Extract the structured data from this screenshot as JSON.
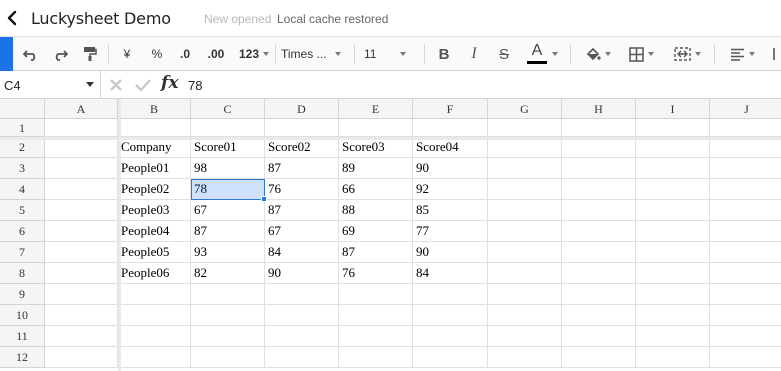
{
  "app": {
    "title": "Luckysheet Demo",
    "status_new": "New opened",
    "status_cache": "Local cache restored"
  },
  "toolbar": {
    "currency_symbol": "¥",
    "percent_symbol": "%",
    "decrease_decimal": ".0",
    "increase_decimal": ".00",
    "number_format": "123",
    "font_family": "Times ...",
    "font_size": "11",
    "bold": "B",
    "italic": "I",
    "strikethrough": "S",
    "text_color_letter": "A"
  },
  "formula_bar": {
    "cell_ref": "C4",
    "fx_label": "fx",
    "value": "78"
  },
  "grid": {
    "columns": [
      "A",
      "B",
      "C",
      "D",
      "E",
      "F",
      "G",
      "H",
      "I",
      "J"
    ],
    "rows": [
      "1",
      "2",
      "3",
      "4",
      "5",
      "6",
      "7",
      "8",
      "9",
      "10",
      "11",
      "12"
    ],
    "cells": {
      "B2": "Company",
      "C2": "Score01",
      "D2": "Score02",
      "E2": "Score03",
      "F2": "Score04",
      "B3": "People01",
      "C3": "98",
      "D3": "87",
      "E3": "89",
      "F3": "90",
      "B4": "People02",
      "C4": "78",
      "D4": "76",
      "E4": "66",
      "F4": "92",
      "B5": "People03",
      "C5": "67",
      "D5": "87",
      "E5": "88",
      "F5": "85",
      "B6": "People04",
      "C6": "87",
      "D6": "67",
      "E6": "69",
      "F6": "77",
      "B7": "People05",
      "C7": "93",
      "D7": "84",
      "E7": "87",
      "F7": "90",
      "B8": "People06",
      "C8": "82",
      "D8": "90",
      "E8": "76",
      "F8": "84"
    },
    "selected_cell": "C4"
  },
  "colors": {
    "accent": "#1a73e8",
    "selection": "#2e7bd6"
  }
}
